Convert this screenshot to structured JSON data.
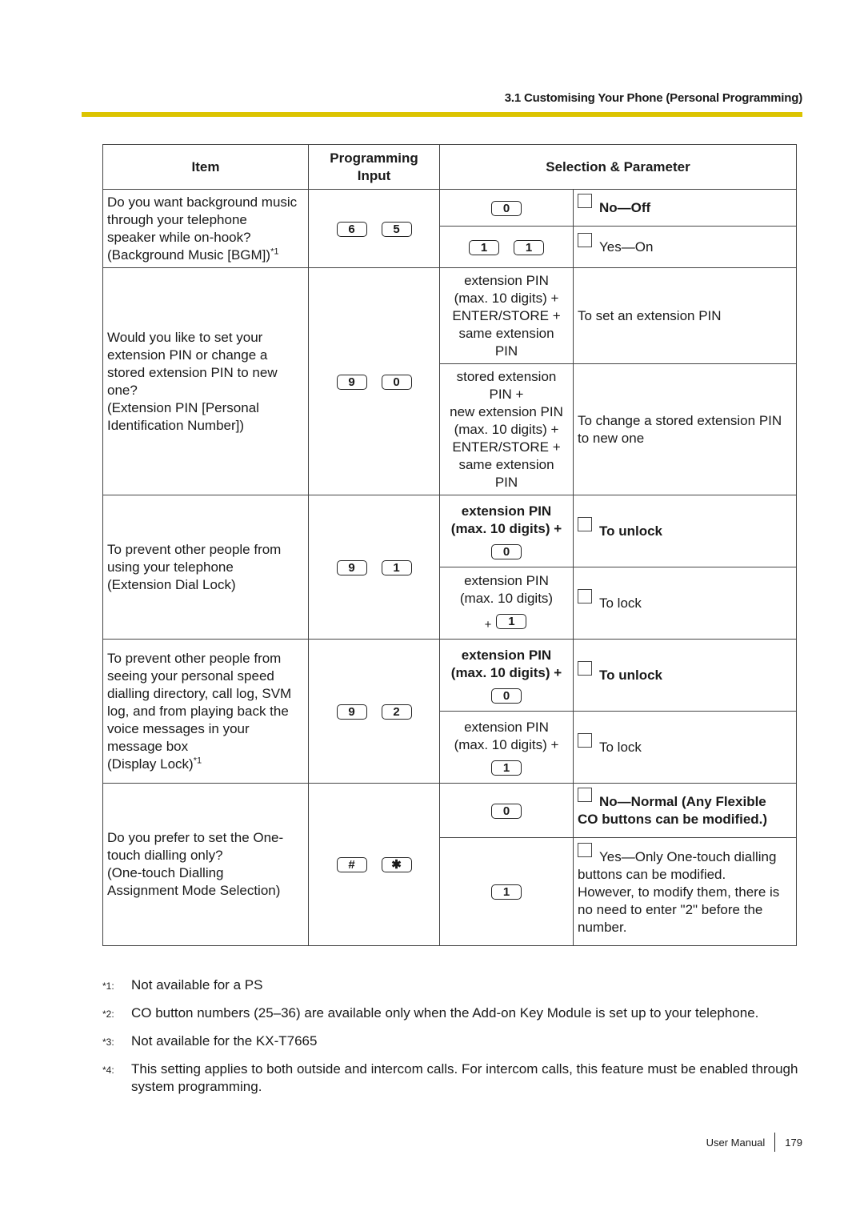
{
  "header": {
    "section_title": "3.1 Customising Your Phone (Personal Programming)",
    "accent_color": "#dcc400"
  },
  "table": {
    "columns": {
      "item": "Item",
      "input": "Programming Input",
      "selection": "Selection & Parameter"
    },
    "rows": [
      {
        "item_lines": [
          "Do you want background music",
          "through your telephone",
          "speaker while on-hook?",
          "(Background Music [BGM])"
        ],
        "item_note": "*1",
        "input_keys": [
          "6",
          "5"
        ],
        "options": [
          {
            "sel_keys": [
              "0"
            ],
            "param": "No—Off",
            "checkbox": true,
            "bold": true
          },
          {
            "sel_keys": [
              "1",
              "1"
            ],
            "param": "Yes—On",
            "checkbox": true,
            "bold": false
          }
        ]
      },
      {
        "item_lines": [
          "Would you like to set your",
          "extension PIN or change a",
          "stored extension PIN to new",
          "one?",
          "(Extension PIN [Personal",
          "Identification Number])"
        ],
        "input_keys": [
          "9",
          "0"
        ],
        "options": [
          {
            "sel_lines": [
              "extension PIN",
              "(max. 10 digits) +",
              "ENTER/STORE +",
              "same extension",
              "PIN"
            ],
            "param": "To set an extension PIN",
            "checkbox": false
          },
          {
            "sel_lines": [
              "stored extension",
              "PIN +",
              "new extension PIN",
              "(max. 10 digits) +",
              "ENTER/STORE +",
              "same extension",
              "PIN"
            ],
            "param_lines": [
              "To change a stored extension PIN",
              "to new one"
            ],
            "checkbox": false
          }
        ]
      },
      {
        "item_lines": [
          "To prevent other people from",
          "using your telephone",
          "(Extension Dial Lock)"
        ],
        "input_keys": [
          "9",
          "1"
        ],
        "options": [
          {
            "sel_lines": [
              "extension PIN",
              "(max. 10 digits) +"
            ],
            "sel_bold": true,
            "sel_keys": [
              "0"
            ],
            "param": "To unlock",
            "checkbox": true,
            "bold": true
          },
          {
            "sel_lines": [
              "extension PIN",
              "(max. 10 digits)"
            ],
            "sel_prefix": "+",
            "sel_keys": [
              "1"
            ],
            "param": "To lock",
            "checkbox": true,
            "bold": false
          }
        ]
      },
      {
        "item_lines": [
          "To prevent other people from",
          "seeing your personal speed",
          "dialling directory, call log, SVM",
          "log, and from playing back the",
          "voice messages in your",
          "message box",
          "(Display Lock)"
        ],
        "item_note": "*1",
        "input_keys": [
          "9",
          "2"
        ],
        "options": [
          {
            "sel_lines": [
              "extension PIN",
              "(max. 10 digits) +"
            ],
            "sel_bold": true,
            "sel_keys": [
              "0"
            ],
            "param": "To unlock",
            "checkbox": true,
            "bold": true
          },
          {
            "sel_lines": [
              "extension PIN",
              "(max. 10 digits) +"
            ],
            "sel_keys": [
              "1"
            ],
            "param": "To lock",
            "checkbox": true,
            "bold": false
          }
        ]
      },
      {
        "item_lines": [
          "Do you prefer to set the One-",
          "touch dialling only?",
          "(One-touch Dialling",
          "Assignment Mode Selection)"
        ],
        "input_keys": [
          "#",
          "✱"
        ],
        "options": [
          {
            "sel_keys": [
              "0"
            ],
            "param_lines": [
              "No—Normal (Any Flexible",
              "CO buttons can be modified.)"
            ],
            "checkbox": true,
            "bold": true
          },
          {
            "sel_keys": [
              "1"
            ],
            "param_lines": [
              "Yes—Only One-touch dialling",
              "buttons can be modified.",
              "However, to modify them, there is",
              "no need to enter \"2\" before the",
              "number."
            ],
            "checkbox": true,
            "bold": false
          }
        ]
      }
    ]
  },
  "footnotes": [
    {
      "mark": "*1",
      "text": "Not available for a PS"
    },
    {
      "mark": "*2",
      "text": "CO button numbers (25–36) are available only when the Add-on Key Module is set up to your telephone."
    },
    {
      "mark": "*3",
      "text": "Not available for the KX-T7665"
    },
    {
      "mark": "*4",
      "text": "This setting applies to both outside and intercom calls. For intercom calls, this feature must be enabled through system programming."
    }
  ],
  "footer": {
    "label": "User Manual",
    "page_number": "179"
  }
}
